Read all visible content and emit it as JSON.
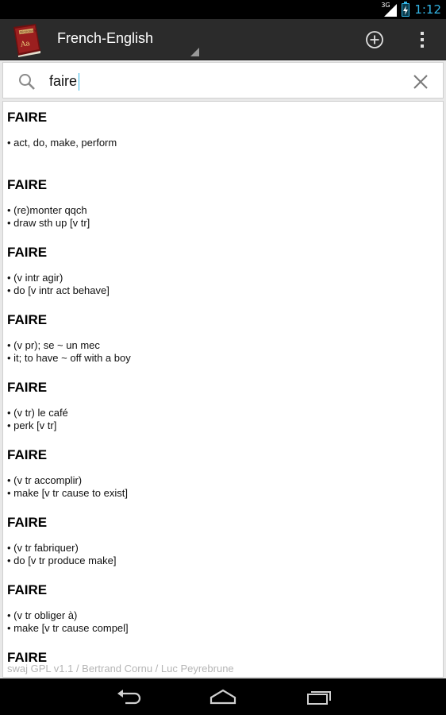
{
  "status": {
    "network": "3G",
    "time": "1:12"
  },
  "toolbar": {
    "title": "French-English",
    "app_icon_label": "Dictionary",
    "app_icon_sub": "Aa"
  },
  "search": {
    "value": "faire"
  },
  "results": [
    {
      "head": "FAIRE",
      "lines": [
        "• act, do, make, perform"
      ]
    },
    {
      "head": "FAIRE",
      "lines": [
        "• (re)monter qqch",
        "• draw sth up [v tr]"
      ]
    },
    {
      "head": "FAIRE",
      "lines": [
        "• (v intr agir)",
        "• do [v intr act behave]"
      ]
    },
    {
      "head": "FAIRE",
      "lines": [
        "• (v pr); se ~ un mec",
        "• it; to have ~ off with a boy"
      ]
    },
    {
      "head": "FAIRE",
      "lines": [
        "• (v tr) le café",
        "• perk [v tr]"
      ]
    },
    {
      "head": "FAIRE",
      "lines": [
        "• (v tr accomplir)",
        "• make [v tr cause to exist]"
      ]
    },
    {
      "head": "FAIRE",
      "lines": [
        "• (v tr fabriquer)",
        "• do [v tr produce make]"
      ]
    },
    {
      "head": "FAIRE",
      "lines": [
        "• (v tr obliger à)",
        "• make [v tr cause compel]"
      ]
    },
    {
      "head": "FAIRE",
      "lines": []
    }
  ],
  "footer": {
    "credit": "swaj GPL v1.1 / Bertrand Cornu / Luc Peyrebrune"
  },
  "icons": {
    "add": "add-circle-icon",
    "menu": "overflow-menu-icon",
    "search": "search-icon",
    "clear": "clear-icon",
    "back": "back-icon",
    "home": "home-icon",
    "recents": "recents-icon"
  },
  "colors": {
    "accent": "#33b5e5",
    "action_bar": "#2b2b2b",
    "book": "#8b1a1a"
  }
}
